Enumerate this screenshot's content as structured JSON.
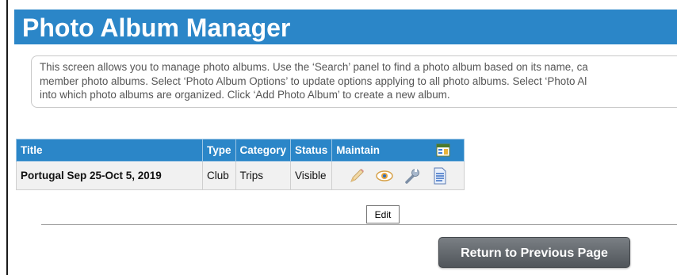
{
  "header": {
    "title": "Photo Album Manager"
  },
  "info": {
    "lines": [
      "This screen allows you to manage photo albums. Use the ‘Search’ panel to find a photo album based on its name, ca",
      "member photo albums. Select ‘Photo Album Options’ to update options applying to all photo albums. Select ‘Photo Al",
      "into which photo albums are organized. Click ‘Add Photo Album’ to create a new album."
    ]
  },
  "table": {
    "columns": [
      "Title",
      "Type",
      "Category",
      "Status",
      "Maintain"
    ],
    "rows": [
      {
        "title": "Portugal Sep 25-Oct 5, 2019",
        "type": "Club",
        "category": "Trips",
        "status": "Visible",
        "actions": [
          "edit-icon",
          "view-icon",
          "settings-wrench-icon",
          "document-icon"
        ]
      }
    ],
    "header_icon": "columns-icon"
  },
  "tooltip": {
    "text": "Edit"
  },
  "footer": {
    "return_label": "Return to Previous Page"
  },
  "colors": {
    "accent": "#2b86c8",
    "button": "#5f6468"
  }
}
